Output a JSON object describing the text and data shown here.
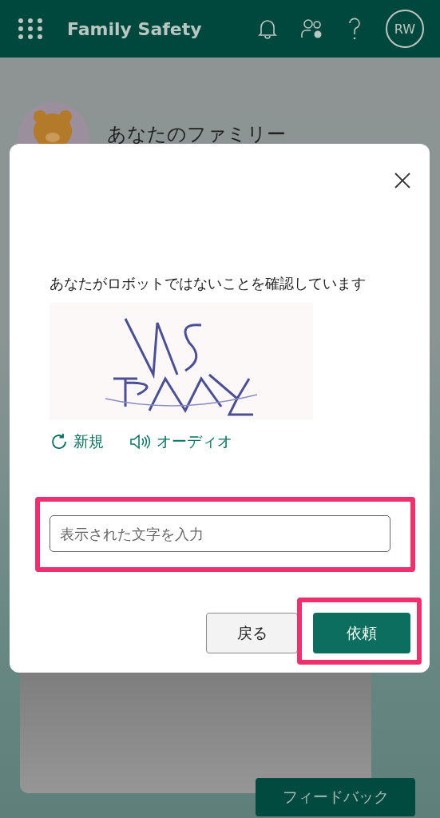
{
  "header": {
    "app_title": "Family Safety",
    "avatar_initials": "RW"
  },
  "family": {
    "title": "あなたのファミリー"
  },
  "dialog": {
    "prompt": "あなたがロボットではないことを確認しています",
    "links": [
      {
        "kind": "refresh",
        "label": "新規"
      },
      {
        "kind": "audio",
        "label": "オーディオ"
      }
    ],
    "input": {
      "placeholder": "表示された文字を入力",
      "highlighted": true
    },
    "buttons": [
      {
        "label": "戻る",
        "kind": "secondary",
        "highlighted": false
      },
      {
        "label": "依頼",
        "kind": "primary",
        "highlighted": true
      }
    ]
  },
  "feedback_button": "フィードバック"
}
